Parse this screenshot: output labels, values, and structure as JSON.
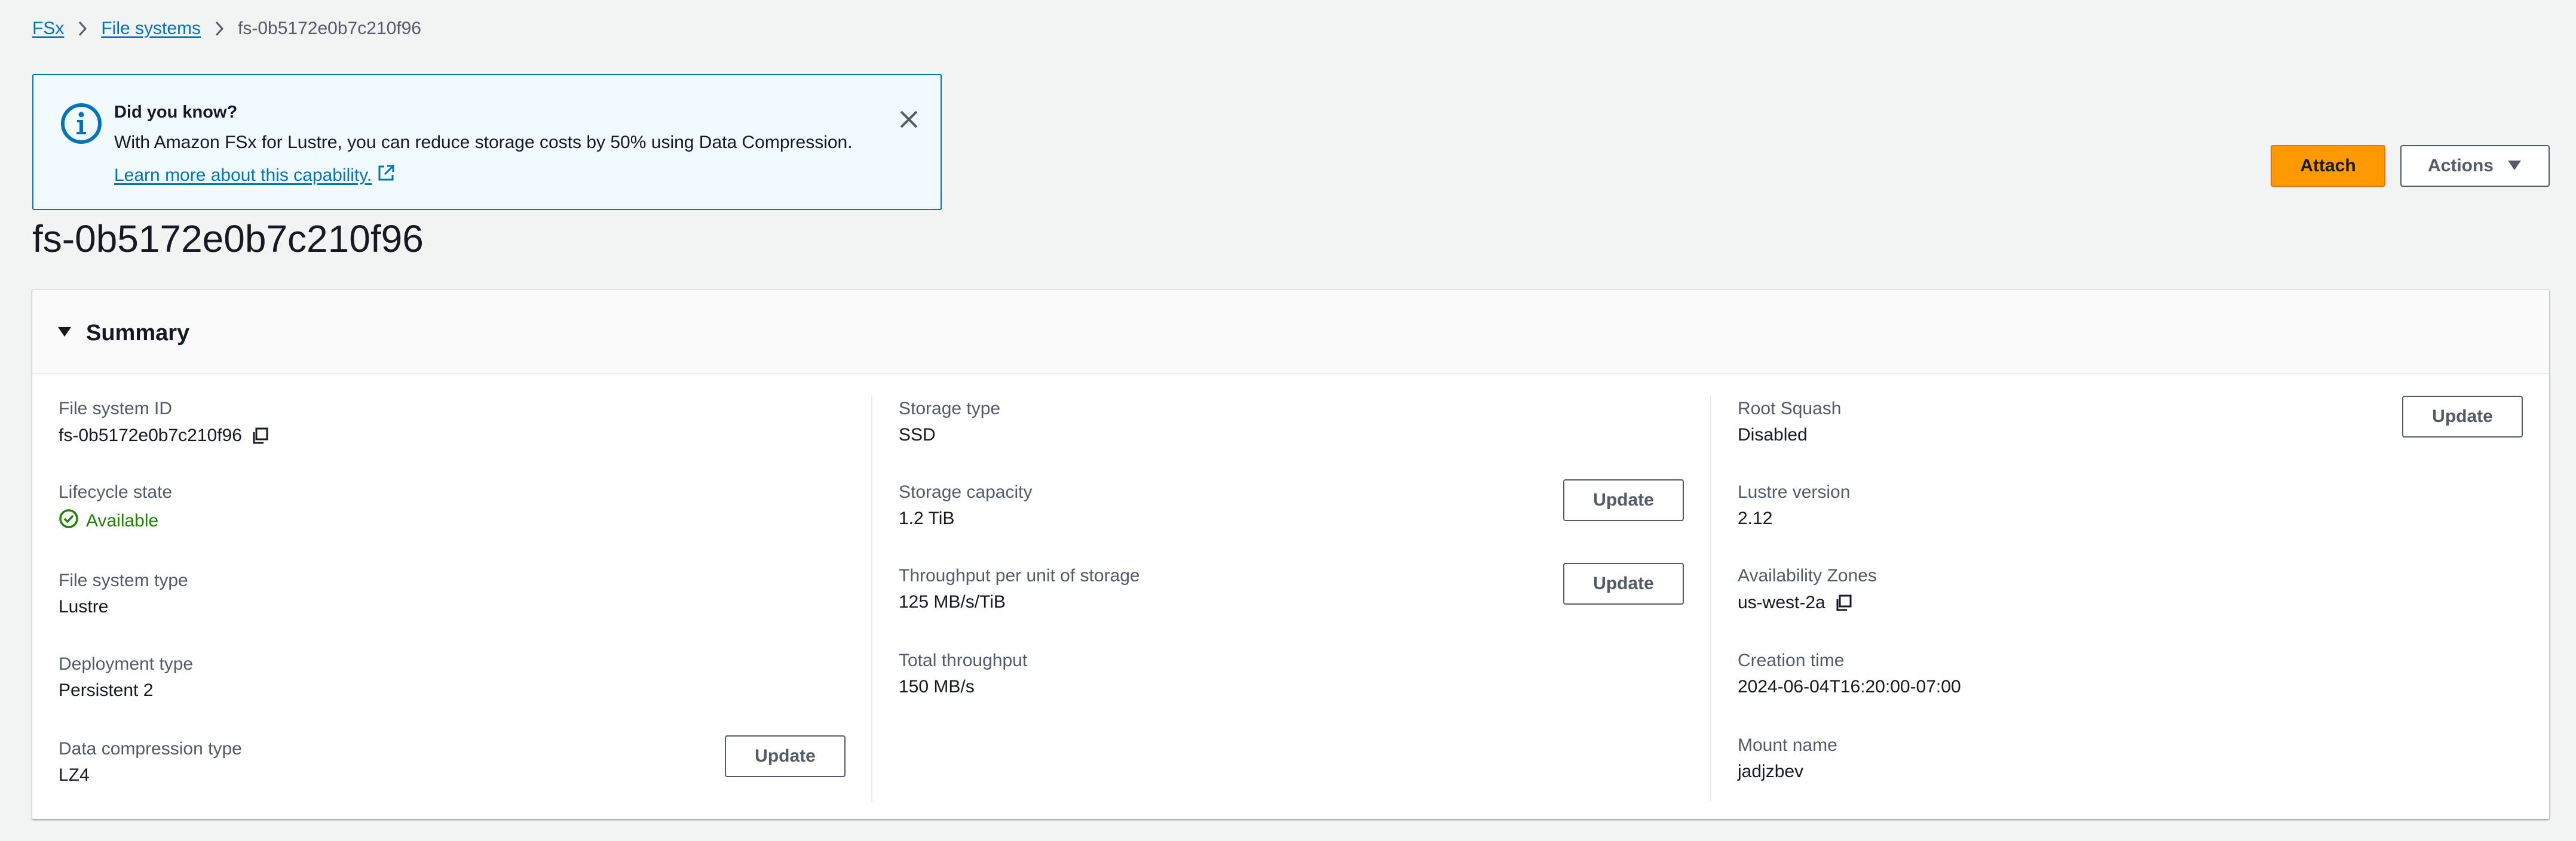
{
  "breadcrumb": {
    "items": [
      "FSx",
      "File systems"
    ],
    "current": "fs-0b5172e0b7c210f96"
  },
  "flash": {
    "title": "Did you know?",
    "body": "With Amazon FSx for Lustre, you can reduce storage costs by 50% using Data Compression.",
    "link": "Learn more about this capability."
  },
  "page": {
    "title": "fs-0b5172e0b7c210f96"
  },
  "header_actions": {
    "attach": "Attach",
    "actions": "Actions"
  },
  "summary": {
    "title": "Summary",
    "update_label": "Update",
    "col1": {
      "file_system_id_label": "File system ID",
      "file_system_id": "fs-0b5172e0b7c210f96",
      "lifecycle_label": "Lifecycle state",
      "lifecycle": "Available",
      "fs_type_label": "File system type",
      "fs_type": "Lustre",
      "deployment_label": "Deployment type",
      "deployment": "Persistent 2",
      "compression_label": "Data compression type",
      "compression": "LZ4"
    },
    "col2": {
      "storage_type_label": "Storage type",
      "storage_type": "SSD",
      "capacity_label": "Storage capacity",
      "capacity": "1.2 TiB",
      "throughput_unit_label": "Throughput per unit of storage",
      "throughput_unit": "125 MB/s/TiB",
      "total_throughput_label": "Total throughput",
      "total_throughput": "150 MB/s"
    },
    "col3": {
      "root_squash_label": "Root Squash",
      "root_squash": "Disabled",
      "lustre_version_label": "Lustre version",
      "lustre_version": "2.12",
      "az_label": "Availability Zones",
      "az": "us-west-2a",
      "creation_label": "Creation time",
      "creation": "2024-06-04T16:20:00-07:00",
      "mount_label": "Mount name",
      "mount": "jadjzbev"
    }
  },
  "colors": {
    "link": "#0073bb",
    "primary": "#ff9900",
    "success": "#1d8102",
    "info_border": "#0073bb",
    "info_bg": "#f1faff"
  },
  "icons": [
    "chevron-right-icon",
    "info-icon",
    "close-icon",
    "external-link-icon",
    "caret-down-icon",
    "copy-icon",
    "status-success-icon"
  ]
}
